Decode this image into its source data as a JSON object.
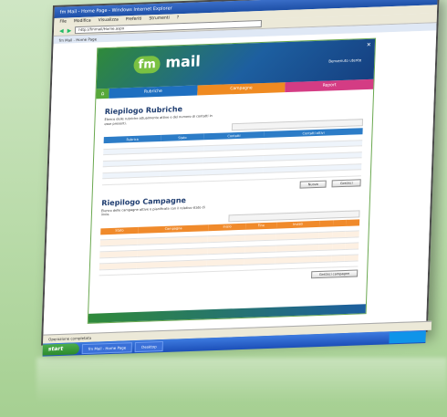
{
  "browser": {
    "window_title": "fm Mail - Home Page - Windows Internet Explorer",
    "menu": [
      "File",
      "Modifica",
      "Visualizza",
      "Preferiti",
      "Strumenti",
      "?"
    ],
    "address": "http://fmmail/Home.aspx",
    "tab": "fm Mail - Home Page",
    "status": "Operazione completata"
  },
  "app": {
    "logo_fm": "fm",
    "logo_mail": "mail",
    "welcome": "Benvenuto utente",
    "nav": {
      "rubriche": "Rubriche",
      "campagne": "Campagne",
      "report": "Report"
    },
    "rubriche": {
      "title": "Riepilogo Rubriche",
      "desc": "Elenco delle rubriche attualmente attive e del numero di contatti in esse presenti.",
      "columns": [
        "Rubrica",
        "Stato",
        "Contatti",
        "Contatti attivi"
      ],
      "rows": [
        [
          "",
          "",
          "",
          ""
        ],
        [
          "",
          "",
          "",
          ""
        ],
        [
          "",
          "",
          "",
          ""
        ],
        [
          "",
          "",
          "",
          ""
        ],
        [
          "",
          "",
          "",
          ""
        ],
        [
          "",
          "",
          "",
          ""
        ],
        [
          "",
          "",
          "",
          ""
        ]
      ],
      "btn_new": "Nuova",
      "btn_manage": "Gestisci"
    },
    "campagne": {
      "title": "Riepilogo Campagne",
      "desc": "Elenco delle campagne attive o pianificate con il relativo stato di invio.",
      "columns": [
        "Stato",
        "Campagna",
        "Inizio",
        "Fine",
        "Inviati",
        "",
        "",
        ""
      ],
      "rows": [
        [
          "",
          "",
          "",
          "",
          "",
          "",
          "",
          ""
        ],
        [
          "",
          "",
          "",
          "",
          "",
          "",
          "",
          ""
        ],
        [
          "",
          "",
          "",
          "",
          "",
          "",
          "",
          ""
        ],
        [
          "",
          "",
          "",
          "",
          "",
          "",
          "",
          ""
        ],
        [
          "",
          "",
          "",
          "",
          "",
          "",
          "",
          ""
        ],
        [
          "",
          "",
          "",
          "",
          "",
          "",
          "",
          ""
        ],
        [
          "",
          "",
          "",
          "",
          "",
          "",
          "",
          ""
        ]
      ],
      "btn_manage": "Gestisci campagne"
    }
  },
  "taskbar": {
    "start": "start",
    "items": [
      "fm Mail - Home Page",
      "Desktop"
    ],
    "clock": ""
  },
  "colors": {
    "rubriche_blue": "#2c7cc7",
    "campagne_orange": "#f08a2b",
    "report_pink": "#d43c84",
    "brand_green": "#7ac142"
  }
}
